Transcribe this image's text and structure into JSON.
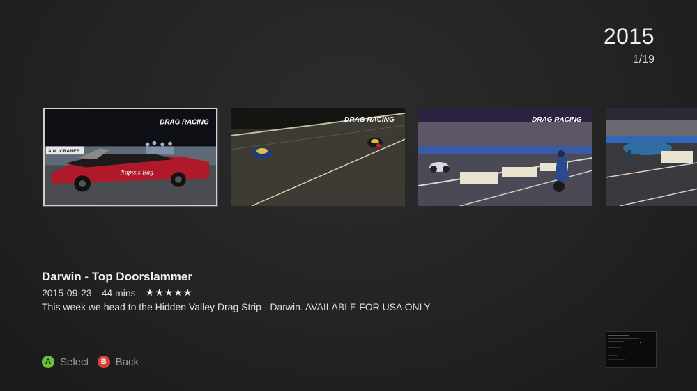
{
  "header": {
    "year": "2015",
    "page_counter": "1/19"
  },
  "carousel": {
    "items": [
      {
        "overlay_text": "DRAG RACING",
        "sign_text": "A.M. CRANES",
        "car_text": "Napisis Bag",
        "selected": true
      },
      {
        "overlay_text": "DRAG RACING",
        "selected": false
      },
      {
        "overlay_text": "DRAG RACING",
        "selected": false
      },
      {
        "overlay_text": "",
        "selected": false
      }
    ]
  },
  "episode": {
    "title": "Darwin - Top Doorslammer",
    "date": "2015-09-23",
    "duration": "44 mins",
    "rating": 5,
    "rating_display": "★★★★★",
    "description": "This week we head to the Hidden Valley Drag Strip - Darwin. AVAILABLE FOR USA ONLY"
  },
  "footer": {
    "select_button": "A",
    "select_label": "Select",
    "back_button": "B",
    "back_label": "Back"
  },
  "colors": {
    "button_a": "#6cbf3a",
    "button_b": "#d9413a",
    "background": "#232323"
  }
}
